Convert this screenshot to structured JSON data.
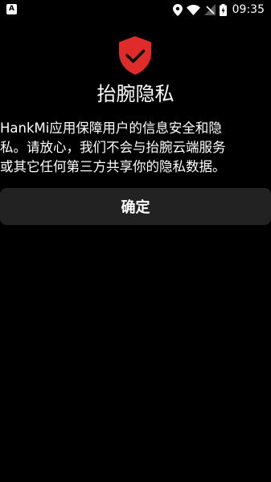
{
  "status_bar": {
    "left_icon": "A",
    "time": "09:35",
    "icons": [
      "location-icon",
      "wifi-icon",
      "signal-off-icon",
      "battery-charging-icon"
    ]
  },
  "dialog": {
    "icon": "shield-check-icon",
    "title": "抬腕隐私",
    "description": "HankMi应用保障用户的信息安全和隐\n私。请放心，我们不会与抬腕云端服务\n或其它任何第三方共享你的隐私数据。",
    "confirm_label": "确定"
  },
  "colors": {
    "background": "#000000",
    "shield": "#E02B2B",
    "button_bg": "#222222",
    "text": "#FFFFFF"
  }
}
